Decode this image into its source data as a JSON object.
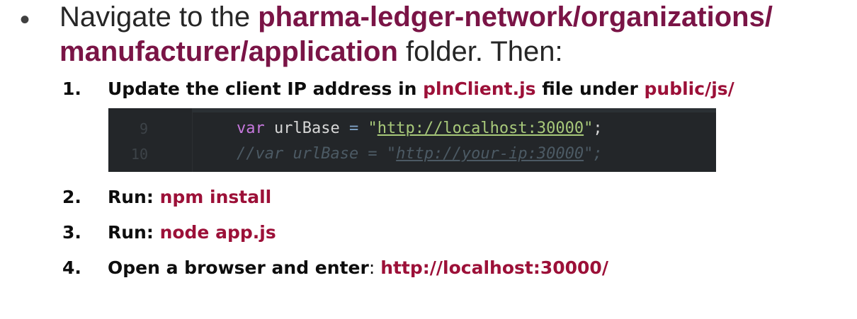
{
  "slide": {
    "bullet_glyph": "•",
    "intro_prefix": "Navigate to the ",
    "intro_path_1": "pharma-ledger-network/organizations/",
    "intro_path_2": "manufacturer/application",
    "intro_suffix": " folder. Then:",
    "colors": {
      "highlight": "#7a1446",
      "step_highlight": "#9c1038",
      "code_bg": "#232629"
    }
  },
  "steps": [
    {
      "number": "1.",
      "text_a": "Update the client IP address in ",
      "highlight_a": "plnClient.js",
      "text_b": " file under ",
      "highlight_b": "public/js/"
    },
    {
      "number": "2.",
      "label": "Run: ",
      "command": "npm install"
    },
    {
      "number": "3.",
      "label": "Run: ",
      "command": "node app.js"
    },
    {
      "number": "4.",
      "label": "Open a browser and enter",
      "colon": ": ",
      "url": "http://localhost:30000/"
    }
  ],
  "code": {
    "lines": [
      {
        "line_number": "9",
        "keyword": "var",
        "identifier": " urlBase ",
        "operator": "=",
        "quote_open": " \"",
        "url": "http://localhost:30000",
        "quote_close": "\"",
        "semicolon": ";"
      },
      {
        "line_number": "10",
        "comment_prefix": "//var urlBase = \"",
        "comment_url": "http://your-ip:30000",
        "comment_suffix": "\";"
      }
    ]
  }
}
